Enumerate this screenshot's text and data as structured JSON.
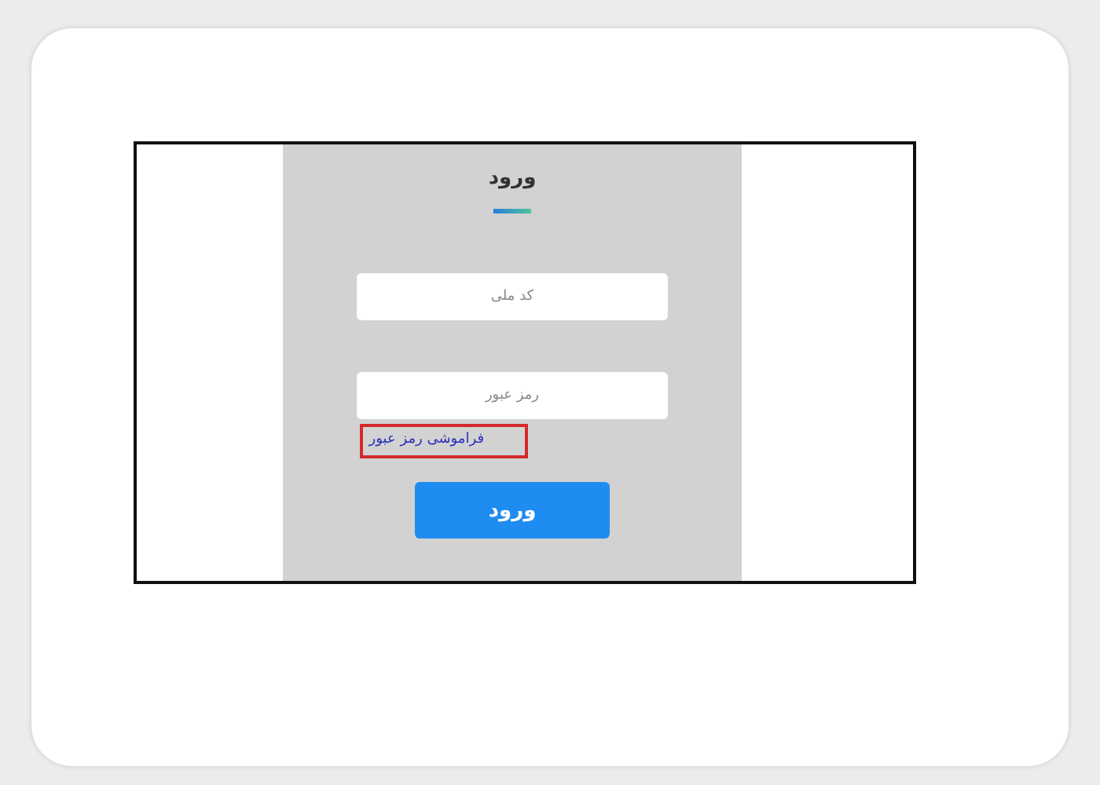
{
  "login_form": {
    "title": "ورود",
    "fields": [
      {
        "placeholder": "کد ملی"
      },
      {
        "placeholder": "رمز عبور"
      }
    ],
    "forgot_password_link": "فراموشی رمز عبور",
    "forgot_password_highlighted": true,
    "submit_button": "ورود"
  }
}
